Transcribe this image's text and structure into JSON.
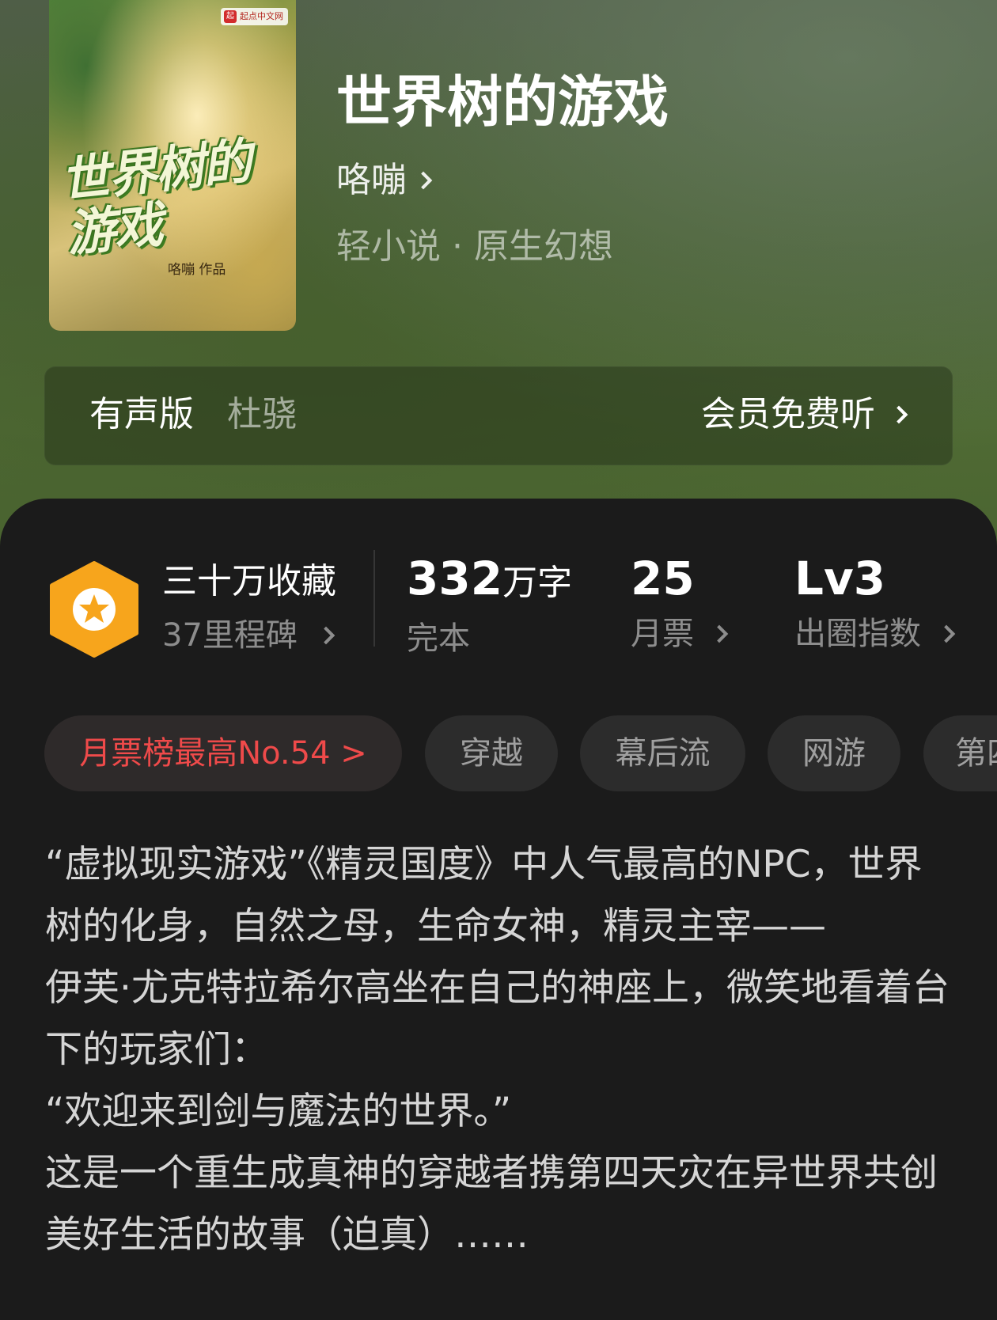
{
  "book": {
    "title": "世界树的游戏",
    "author": "咯嘣",
    "genre": "轻小说 · 原生幻想"
  },
  "cover": {
    "badge": "起点中文网",
    "title": "世界树的游戏",
    "author_credit": "咯嘣 作品"
  },
  "audio": {
    "label": "有声版",
    "narrator": "杜骁",
    "action": "会员免费听"
  },
  "stats": {
    "favorites": "三十万收藏",
    "milestone": "37里程碑",
    "words_value": "332",
    "words_unit": "万字",
    "words_label": "完本",
    "monthly_votes_value": "25",
    "monthly_votes_label": "月票",
    "influence_value": "Lv3",
    "influence_label": "出圈指数",
    "icon": "star-hexagon-icon",
    "accent_color": "#f7a51c"
  },
  "tags": [
    {
      "label": "月票榜最高No.54 >",
      "color": "#ef4a4a"
    },
    {
      "label": "穿越"
    },
    {
      "label": "幕后流"
    },
    {
      "label": "网游"
    },
    {
      "label": "第四天灾"
    }
  ],
  "intro": [
    "“虚拟现实游戏”《精灵国度》中人气最高的NPC，世界树的化身，自然之母，生命女神，精灵主宰——",
    "伊芙·尤克特拉希尔高坐在自己的神座上，微笑地看着台下的玩家们：",
    "“欢迎来到剑与魔法的世界。”",
    "这是一个重生成真神的穿越者携第四天灾在异世界共创美好生活的故事（迫真）……"
  ]
}
